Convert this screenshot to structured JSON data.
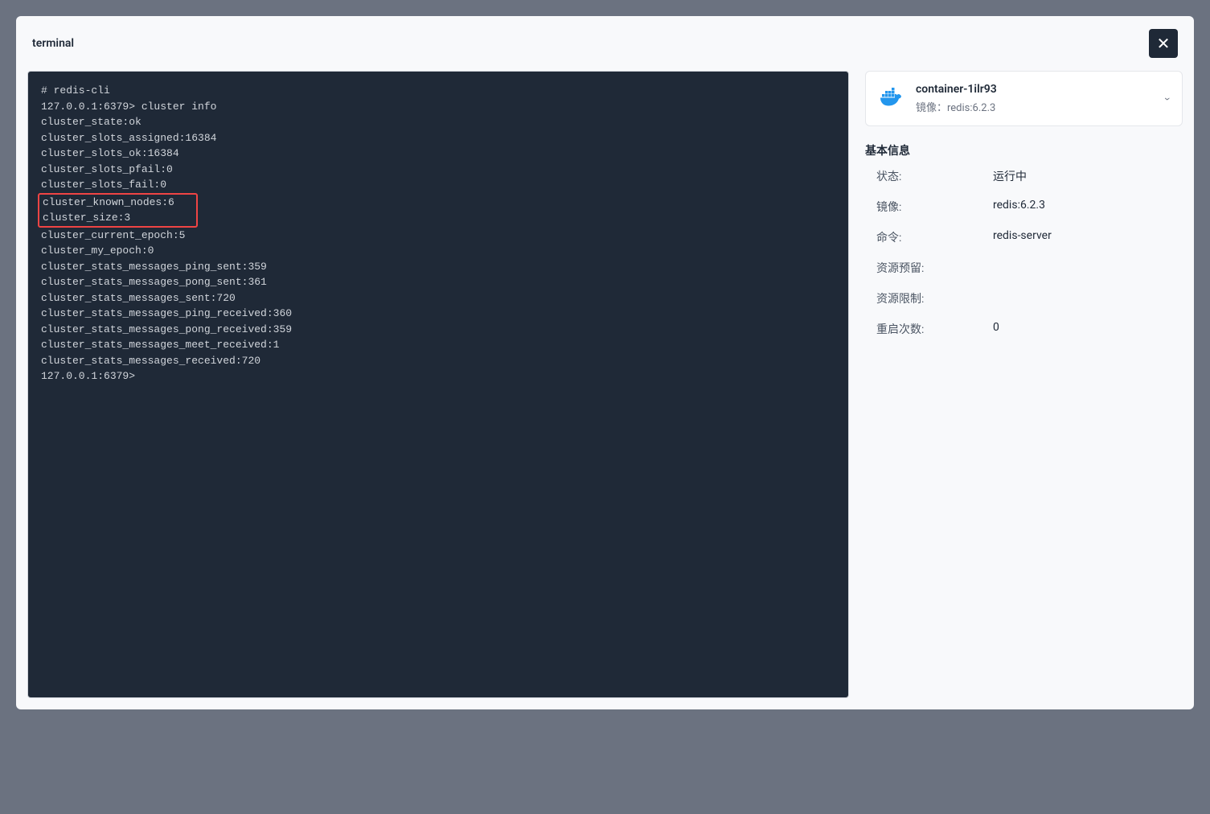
{
  "modal": {
    "title": "terminal"
  },
  "terminal": {
    "l0": "# redis-cli",
    "l1": "127.0.0.1:6379> cluster info",
    "l2": "cluster_state:ok",
    "l3": "cluster_slots_assigned:16384",
    "l4": "cluster_slots_ok:16384",
    "l5": "cluster_slots_pfail:0",
    "l6": "cluster_slots_fail:0",
    "l7": "cluster_known_nodes:6",
    "l8": "cluster_size:3          ",
    "l9": "cluster_current_epoch:5",
    "l10": "cluster_my_epoch:0",
    "l11": "cluster_stats_messages_ping_sent:359",
    "l12": "cluster_stats_messages_pong_sent:361",
    "l13": "cluster_stats_messages_sent:720",
    "l14": "cluster_stats_messages_ping_received:360",
    "l15": "cluster_stats_messages_pong_received:359",
    "l16": "cluster_stats_messages_meet_received:1",
    "l17": "cluster_stats_messages_received:720",
    "l18": "127.0.0.1:6379> "
  },
  "container": {
    "name": "container-1ilr93",
    "image_label": "镜像：redis:6.2.3"
  },
  "basic_info": {
    "section_title": "基本信息",
    "rows": {
      "status_label": "状态:",
      "status_value": "运行中",
      "image_label": "镜像:",
      "image_value": "redis:6.2.3",
      "command_label": "命令:",
      "command_value": "redis-server",
      "reserve_label": "资源预留:",
      "reserve_value": "",
      "limit_label": "资源限制:",
      "limit_value": "",
      "restart_label": "重启次数:",
      "restart_value": "0"
    }
  }
}
